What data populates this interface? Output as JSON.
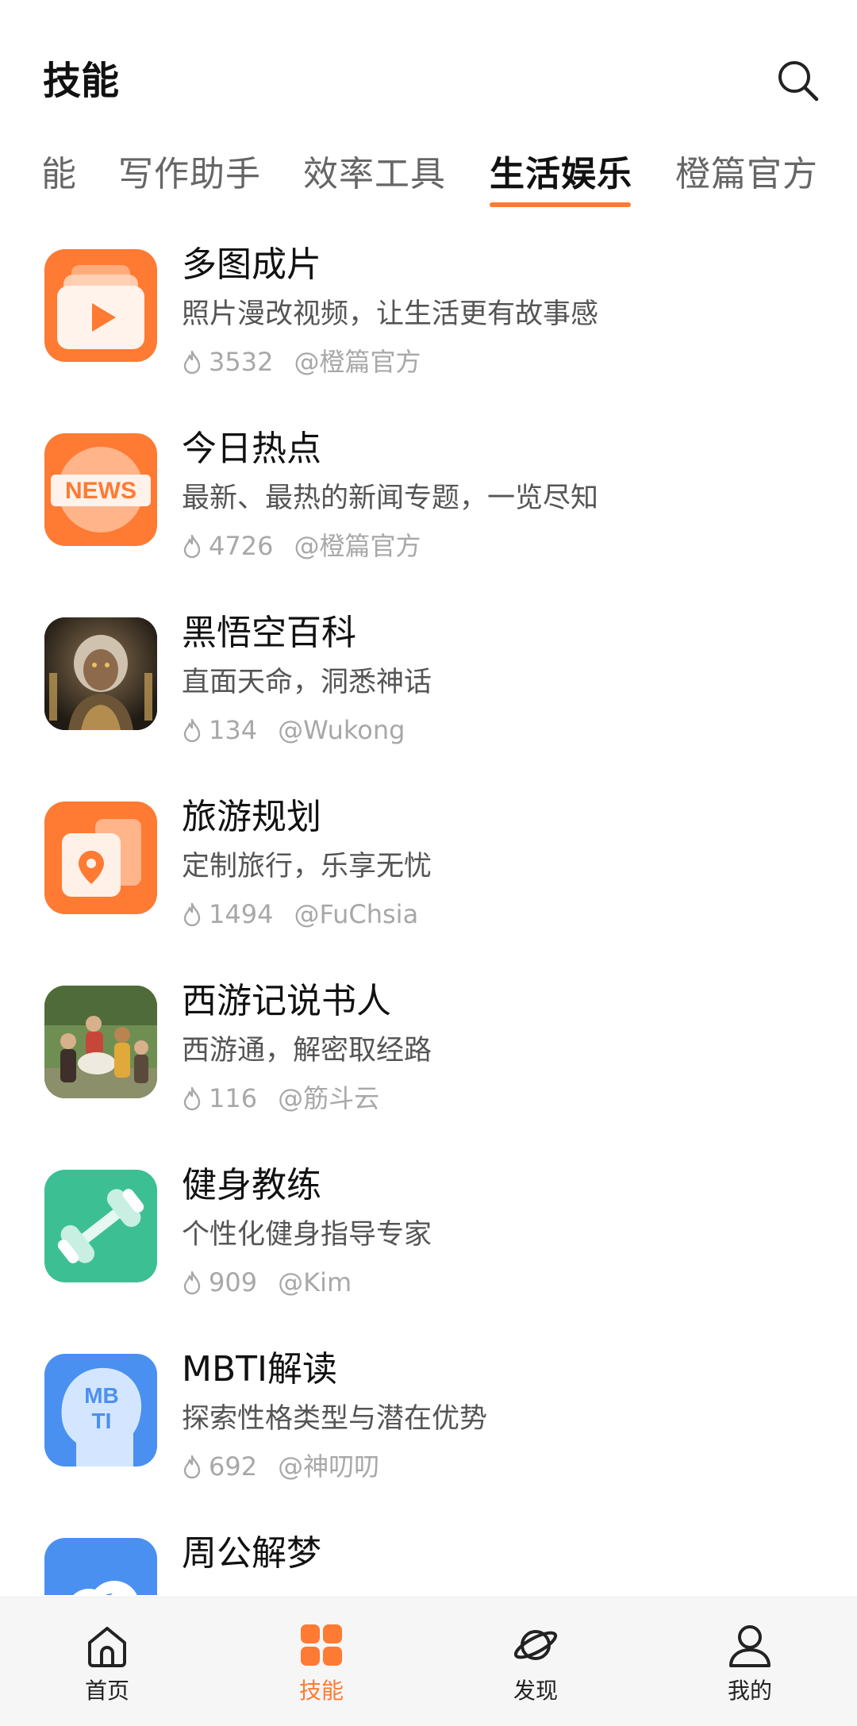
{
  "header": {
    "title": "技能"
  },
  "tabs": [
    {
      "label": "能"
    },
    {
      "label": "写作助手"
    },
    {
      "label": "效率工具"
    },
    {
      "label": "生活娱乐",
      "active": true
    },
    {
      "label": "橙篇官方"
    }
  ],
  "skills": [
    {
      "title": "多图成片",
      "desc": "照片漫改视频，让生活更有故事感",
      "count": "3532",
      "author": "@橙篇官方",
      "icon": "video-play-icon"
    },
    {
      "title": "今日热点",
      "desc": "最新、最热的新闻专题，一览尽知",
      "count": "4726",
      "author": "@橙篇官方",
      "icon": "news-icon",
      "icon_text": "NEWS"
    },
    {
      "title": "黑悟空百科",
      "desc": "直面天命，洞悉神话",
      "count": "134",
      "author": "@Wukong",
      "icon": "wukong-portrait-icon"
    },
    {
      "title": "旅游规划",
      "desc": "定制旅行，乐享无忧",
      "count": "1494",
      "author": "@FuChsia",
      "icon": "map-pin-icon"
    },
    {
      "title": "西游记说书人",
      "desc": "西游通，解密取经路",
      "count": "116",
      "author": "@筋斗云",
      "icon": "journey-west-picture-icon"
    },
    {
      "title": "健身教练",
      "desc": "个性化健身指导专家",
      "count": "909",
      "author": "@Kim",
      "icon": "dumbbell-icon"
    },
    {
      "title": "MBTI解读",
      "desc": "探索性格类型与潜在优势",
      "count": "692",
      "author": "@神叨叨",
      "icon": "head-profile-icon",
      "icon_text_1": "MB",
      "icon_text_2": "TI"
    },
    {
      "title": "周公解梦",
      "desc": "",
      "count": "",
      "author": "",
      "icon": "cloud-moon-icon"
    }
  ],
  "bottom_nav": [
    {
      "label": "首页",
      "icon": "home-icon"
    },
    {
      "label": "技能",
      "icon": "grid-icon",
      "active": true
    },
    {
      "label": "发现",
      "icon": "planet-icon"
    },
    {
      "label": "我的",
      "icon": "person-icon"
    }
  ],
  "colors": {
    "accent": "#ff7a33",
    "fitness_green": "#3dbf94",
    "mbti_blue": "#4a90f0"
  }
}
